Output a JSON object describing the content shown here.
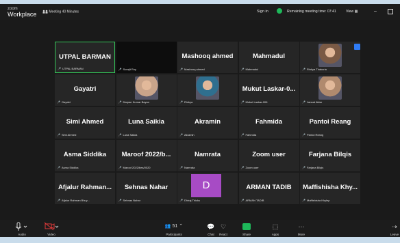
{
  "titlebar": {
    "brand_small": "zoom",
    "brand_large": "Workplace",
    "meeting_label": "Meeting 40 Minutes",
    "sign_in": "Sign in",
    "remaining": "Remaining meeting time: 07:41",
    "view": "View"
  },
  "tiles": [
    {
      "name": "UTPAL BARMAN",
      "tag": "UTPAL BARMAN",
      "active": true
    },
    {
      "name": "",
      "tag": "Surajit Roy",
      "dark": true
    },
    {
      "name": "Mashooq ahmed",
      "tag": "Mashooq ahmed"
    },
    {
      "name": "Mahmadul",
      "tag": "Mahmadul"
    },
    {
      "name": "",
      "tag": "Rinkya Thakuria",
      "photo": true
    },
    {
      "name": "Gayatri",
      "tag": "Gayatri"
    },
    {
      "name": "",
      "tag": "Darpan Kumar Bayan",
      "photo": true
    },
    {
      "name": "",
      "tag": "Rinkya",
      "photo": true
    },
    {
      "name": "Mukut Laskar-0...",
      "tag": "Mukut Laskar-006"
    },
    {
      "name": "",
      "tag": "Jannat Aktar",
      "photo": true
    },
    {
      "name": "Simi Ahmed",
      "tag": "Simi Ahmed"
    },
    {
      "name": "Luna Saikia",
      "tag": "Luna Saikia"
    },
    {
      "name": "Akramin",
      "tag": "Akramin"
    },
    {
      "name": "Fahmida",
      "tag": "Fahmida"
    },
    {
      "name": "Pantoi Reang",
      "tag": "Pantoi Reang"
    },
    {
      "name": "Asma Siddika",
      "tag": "Asma Siddika"
    },
    {
      "name": "Maroof 2022/b...",
      "tag": "Maroof 2022/bes/0020"
    },
    {
      "name": "Namrata",
      "tag": "Namrata"
    },
    {
      "name": "Zoom user",
      "tag": "Zoom user"
    },
    {
      "name": "Farjana Bilqis",
      "tag": "Farjana Bilqis"
    },
    {
      "name": "Afjalur Rahman...",
      "tag": "Afjalur Rahman Bhuy..."
    },
    {
      "name": "Sehnas Nahar",
      "tag": "Sehnas Nahar"
    },
    {
      "name": "",
      "tag": "Dhiraj Thicks",
      "avatar": "D"
    },
    {
      "name": "ARMAN TADIB",
      "tag": "ARMAN TADIB"
    },
    {
      "name": "Maffishisha Khy...",
      "tag": "Maffishisha Khylep"
    }
  ],
  "bottombar": {
    "audio": "Audio",
    "video": "Video",
    "participants": "Participants",
    "participants_count": "51",
    "chat": "Chat",
    "react": "React",
    "share": "Share",
    "apps": "Apps",
    "more": "More",
    "leave": "Leave"
  }
}
